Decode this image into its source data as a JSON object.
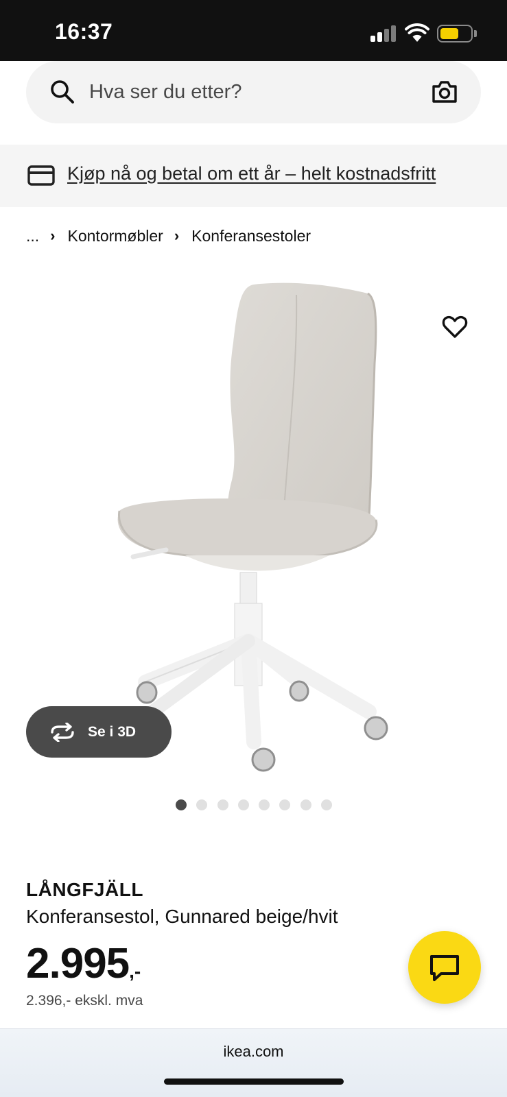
{
  "status_bar": {
    "time": "16:37"
  },
  "search": {
    "placeholder": "Hva ser du etter?"
  },
  "promo": {
    "text": "Kjøp nå og betal om ett år – helt kostnadsfritt"
  },
  "breadcrumb": {
    "ellipsis": "...",
    "items": [
      "Kontormøbler",
      "Konferansestoler"
    ]
  },
  "gallery": {
    "view_3d_label": "Se i 3D",
    "image_count": 8,
    "active_index": 0
  },
  "product": {
    "name": "LÅNGFJÄLL",
    "description": "Konferansestol, Gunnared beige/hvit",
    "price": "2.995",
    "price_suffix": ",-",
    "price_ex_vat": "2.396,- ekskl. mva"
  },
  "browser": {
    "url": "ikea.com"
  },
  "colors": {
    "status_bar": "#111111",
    "search_bg": "#f3f3f3",
    "promo_bg": "#f5f5f5",
    "button_dark": "#4a4a4a",
    "chat_fab": "#fad914",
    "battery": "#f5d000"
  },
  "icons": [
    "search-icon",
    "camera-icon",
    "credit-card-icon",
    "chevron-right-icon",
    "heart-icon",
    "rotate-3d-icon",
    "chat-icon"
  ]
}
